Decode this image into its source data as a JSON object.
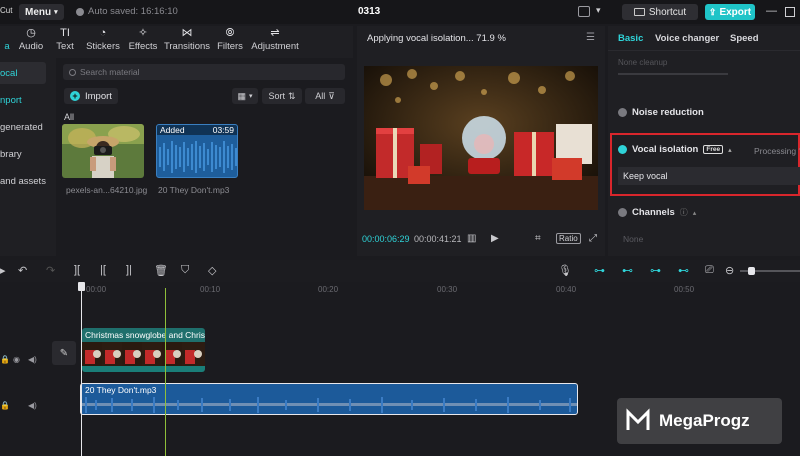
{
  "topbar": {
    "logo_fragment": "Cut",
    "menu_label": "Menu",
    "autosave_text": "Auto saved: 16:16:10",
    "project_title": "0313",
    "shortcut_label": "Shortcut",
    "export_label": "Export"
  },
  "toolbar": {
    "tools": [
      "Audio",
      "Text",
      "Stickers",
      "Effects",
      "Transitions",
      "Filters",
      "Adjustment"
    ],
    "first_fragment": "a"
  },
  "sidebar": {
    "items": [
      "ocal",
      "nport",
      "generated",
      "brary",
      "and assets"
    ]
  },
  "media": {
    "search_placeholder": "Search material",
    "import_label": "Import",
    "sort_label": "Sort",
    "filter_all": "All",
    "section_label": "All",
    "items": [
      {
        "name": "pexels-an...64210.jpg"
      },
      {
        "name": "20 They Don't.mp3",
        "badge": "Added",
        "duration": "03:59"
      }
    ]
  },
  "preview": {
    "status": "Applying vocal isolation...  71.9 %",
    "current_time": "00:00:06:29",
    "total_time": "00:00:41:21",
    "ratio_label": "Ratio"
  },
  "right_panel": {
    "tabs": [
      "Basic",
      "Voice changer",
      "Speed"
    ],
    "active_tab": "Basic",
    "faded_row": "None cleanup",
    "noise_reduction": "Noise reduction",
    "vocal_isolation": "Vocal isolation",
    "free_badge": "Free",
    "processing": "Processing  ?",
    "keep_vocal": "Keep vocal",
    "channels": "Channels",
    "channels_value": "None"
  },
  "timeline": {
    "ruler_labels": [
      "00:00",
      "00:10",
      "00:20",
      "00:30",
      "00:40",
      "00:50"
    ],
    "video_clip_label": "Christmas snowglobe and Christm",
    "audio_clip_label": "20 They Don't.mp3",
    "playhead_fraction": 0.0
  },
  "watermark": {
    "text": "MegaProgz"
  },
  "colors": {
    "accent": "#2fd3d8",
    "highlight_box": "#d9262c",
    "audio_clip": "#1c5a9a",
    "video_clip": "#1f6f6c"
  }
}
